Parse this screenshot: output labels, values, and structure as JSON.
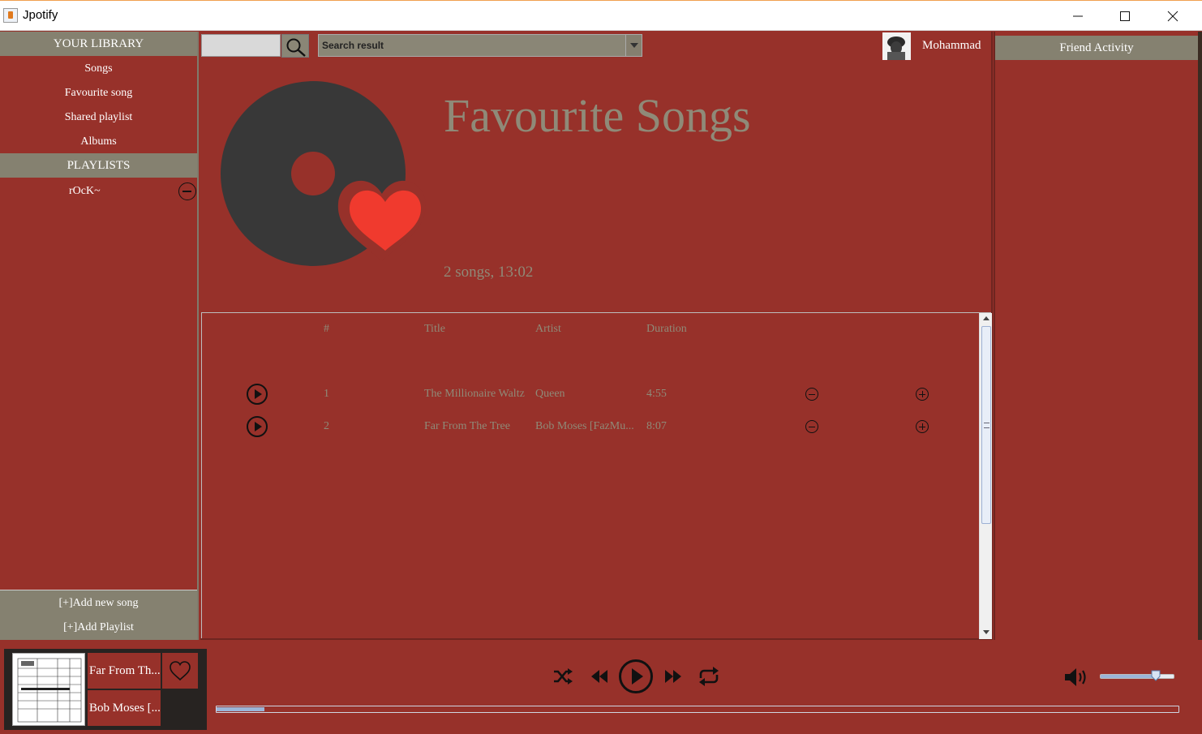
{
  "window": {
    "title": "Jpotify"
  },
  "sidebar": {
    "library_header": "YOUR LIBRARY",
    "items": [
      {
        "label": "Songs"
      },
      {
        "label": "Favourite song"
      },
      {
        "label": "Shared playlist"
      },
      {
        "label": "Albums"
      }
    ],
    "playlists_header": "PLAYLISTS",
    "playlists": [
      {
        "label": "rOcK~"
      }
    ],
    "add_song": "[+]Add new song",
    "add_playlist": "[+]Add Playlist"
  },
  "search": {
    "value": "",
    "result_label": "Search result"
  },
  "user": {
    "name": "Mohammad"
  },
  "playlist": {
    "title": "Favourite Songs",
    "meta": "2 songs, 13:02"
  },
  "table": {
    "headers": {
      "num": "#",
      "title": "Title",
      "artist": "Artist",
      "duration": "Duration"
    },
    "rows": [
      {
        "num": "1",
        "title": "The Millionaire Waltz",
        "artist": "Queen",
        "duration": "4:55"
      },
      {
        "num": "2",
        "title": "Far From The Tree",
        "artist": "Bob Moses [FazMu...",
        "duration": "8:07"
      }
    ]
  },
  "friends": {
    "header": "Friend Activity"
  },
  "player": {
    "now_title": "Far From Th...",
    "now_artist": "Bob Moses [...",
    "progress": 0.05,
    "volume": 0.75
  },
  "colors": {
    "background": "#97312a",
    "header_bar": "#858170",
    "muted_text": "#8f8a78",
    "heart": "#f03a2e",
    "disc": "#383838"
  },
  "icons": [
    "search-icon",
    "chevron-down-icon",
    "minus-circle-icon",
    "play-circle-icon",
    "plus-circle-icon",
    "heart-icon",
    "shuffle-icon",
    "previous-icon",
    "next-icon",
    "repeat-icon",
    "volume-icon"
  ]
}
